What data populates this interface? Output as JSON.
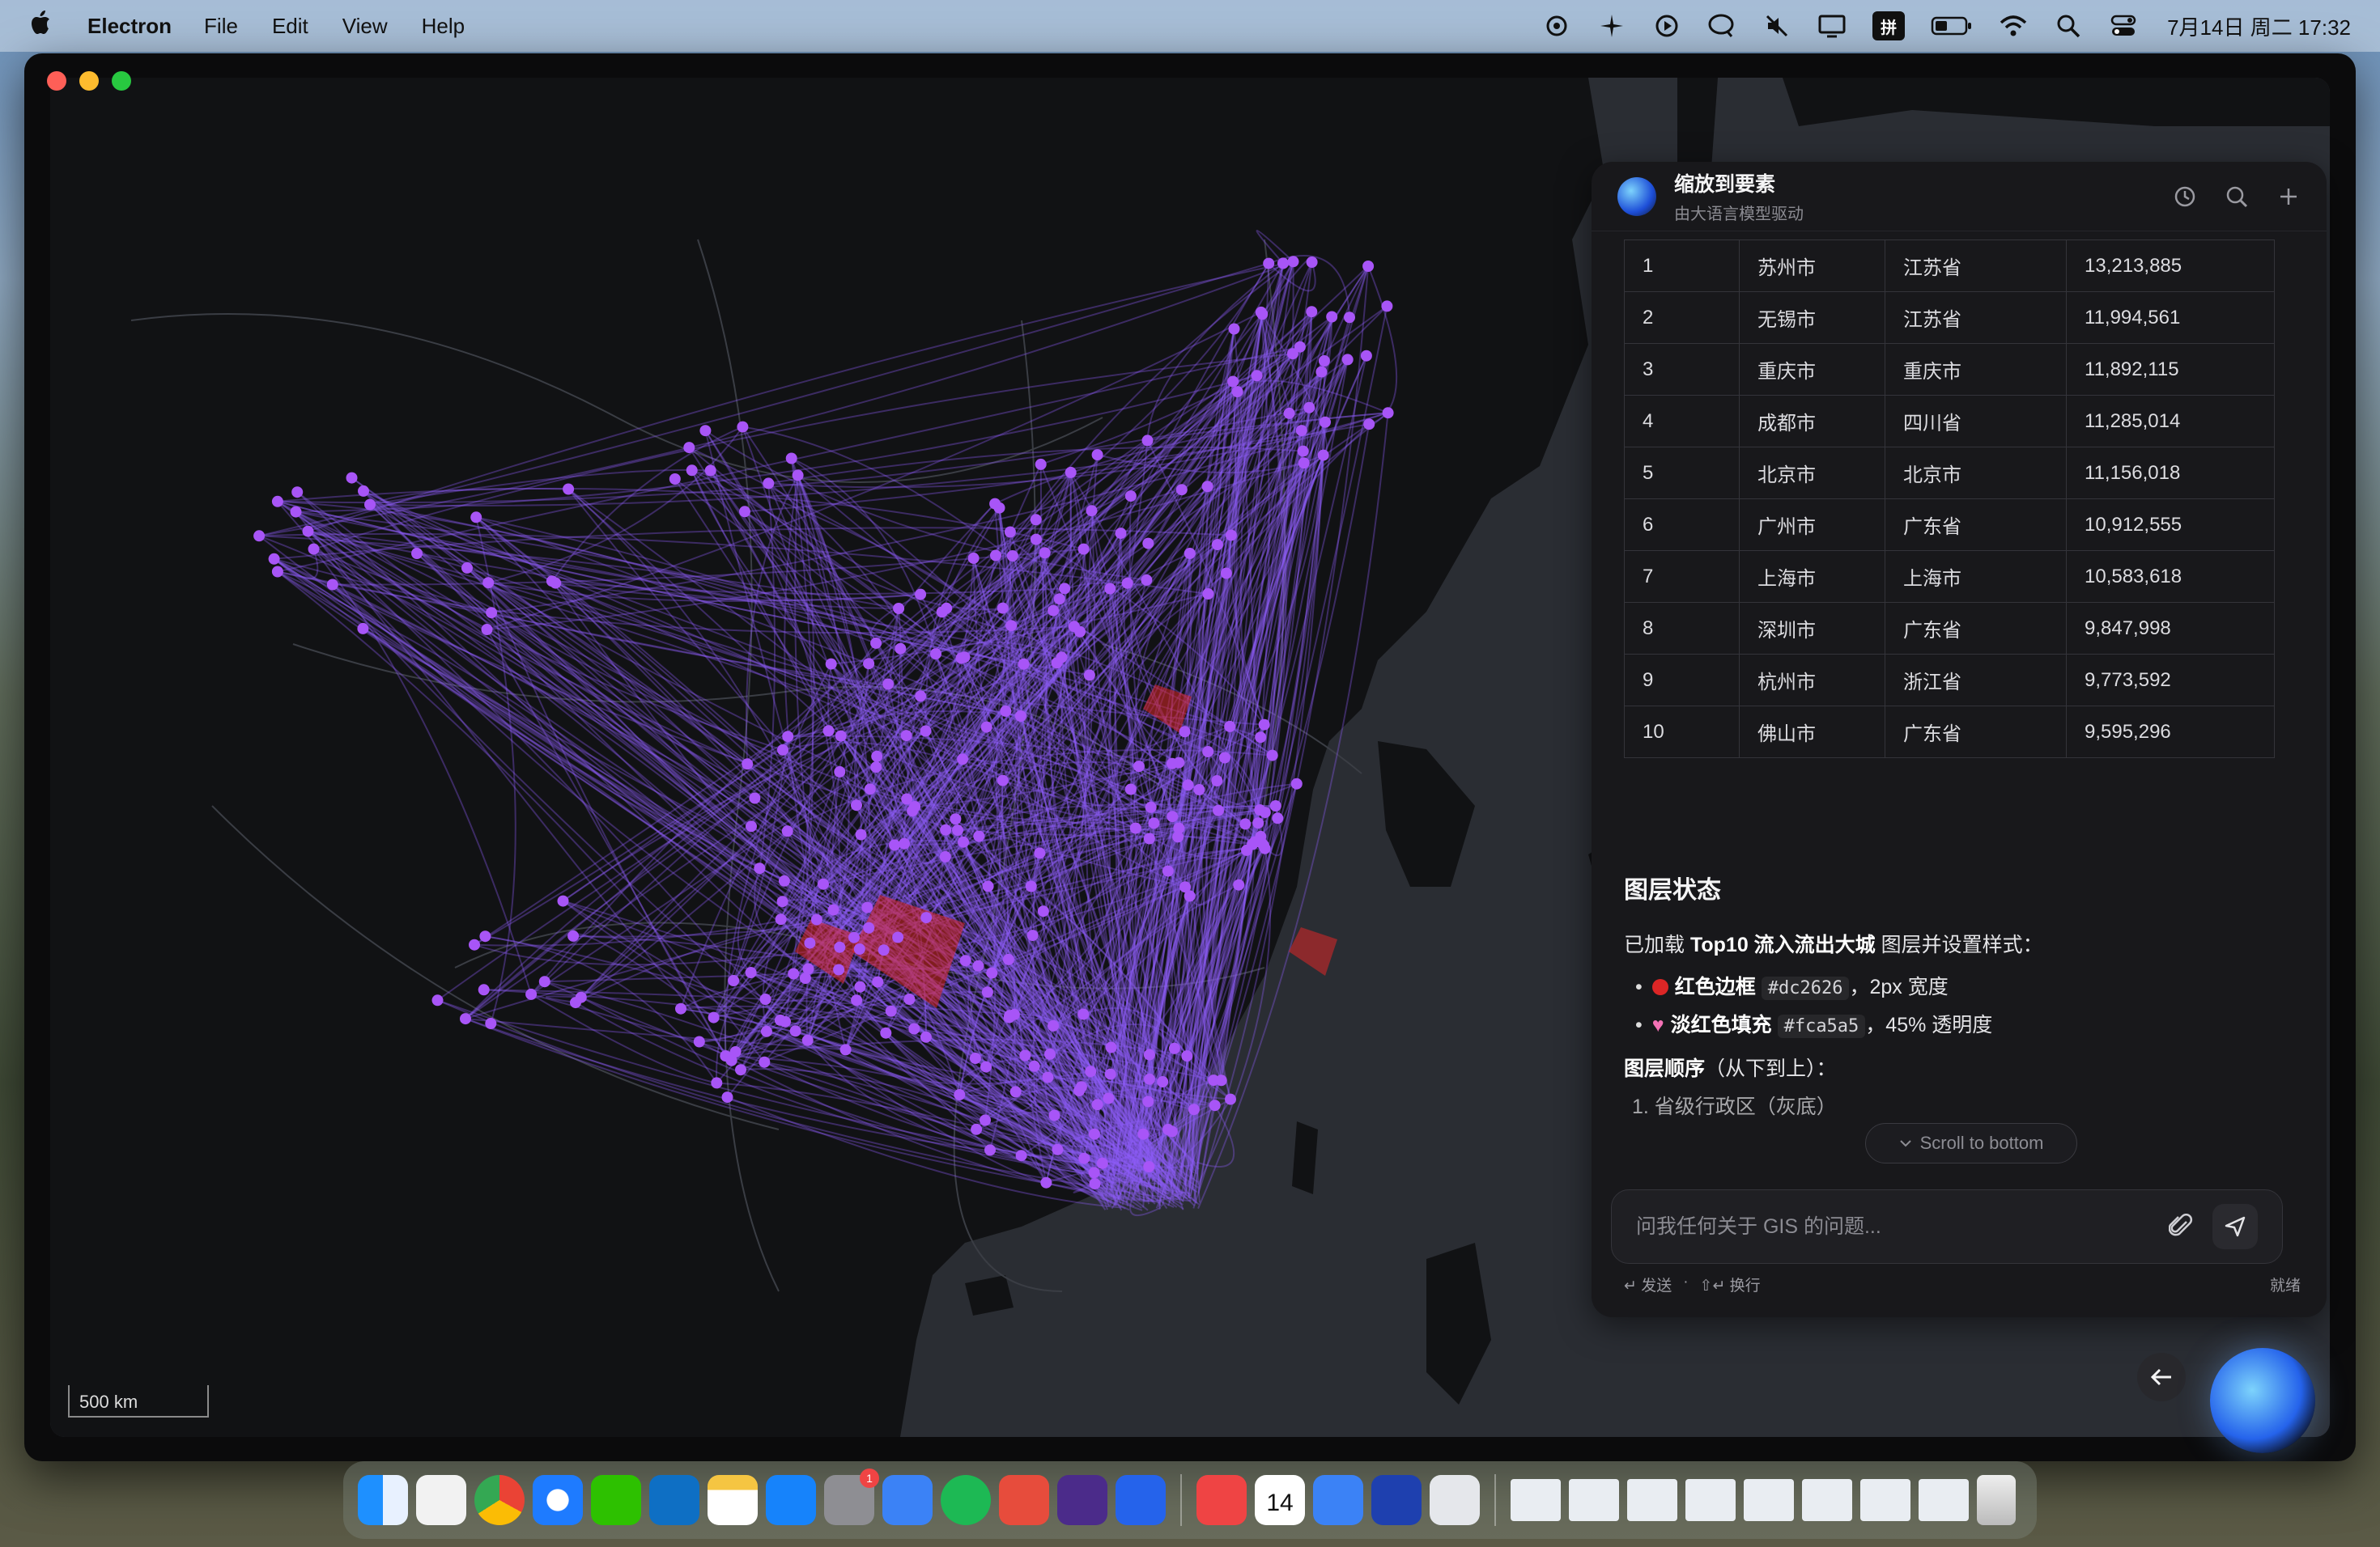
{
  "menubar": {
    "app_name": "Electron",
    "menus": [
      "File",
      "Edit",
      "View",
      "Help"
    ],
    "clock": "7月14日 周二  17:32",
    "input_method": "拼"
  },
  "map": {
    "scale_label": "500 km",
    "colors": {
      "background": "#2a2d33",
      "land": "#111214",
      "flow": "#8b5cf6",
      "node": "#a855f7",
      "highlight": "#dc2626"
    }
  },
  "panel": {
    "title": "缩放到要素",
    "subtitle": "由大语言模型驱动",
    "header_icons": [
      "history-icon",
      "search-icon",
      "plus-icon"
    ],
    "table": [
      [
        "1",
        "苏州市",
        "江苏省",
        "13,213,885"
      ],
      [
        "2",
        "无锡市",
        "江苏省",
        "11,994,561"
      ],
      [
        "3",
        "重庆市",
        "重庆市",
        "11,892,115"
      ],
      [
        "4",
        "成都市",
        "四川省",
        "11,285,014"
      ],
      [
        "5",
        "北京市",
        "北京市",
        "11,156,018"
      ],
      [
        "6",
        "广州市",
        "广东省",
        "10,912,555"
      ],
      [
        "7",
        "上海市",
        "上海市",
        "10,583,618"
      ],
      [
        "8",
        "深圳市",
        "广东省",
        "9,847,998"
      ],
      [
        "9",
        "杭州市",
        "浙江省",
        "9,773,592"
      ],
      [
        "10",
        "佛山市",
        "广东省",
        "9,595,296"
      ]
    ],
    "layer_status": {
      "heading": "图层状态",
      "loaded_prefix": "已加载 ",
      "loaded_layer": "Top10 流入流出大城",
      "loaded_suffix": " 图层并设置样式：",
      "bullet1_label": "红色边框",
      "bullet1_code": "#dc2626",
      "bullet1_rest": "，2px 宽度",
      "bullet2_label": "淡红色填充",
      "bullet2_code": "#fca5a5",
      "bullet2_rest": "，45% 透明度",
      "order_label": "图层顺序",
      "order_rest": "（从下到上）：",
      "order_item1": "1. 省级行政区（灰底）"
    },
    "scroll_to_bottom": "Scroll to bottom",
    "input_placeholder": "问我任何关于 GIS 的问题...",
    "hint_send": "↵ 发送",
    "hint_dot": "·",
    "hint_newline": "⇧↵ 换行",
    "status": "就绪"
  },
  "dock": {
    "badge_count": "1",
    "calendar_day": "14"
  }
}
